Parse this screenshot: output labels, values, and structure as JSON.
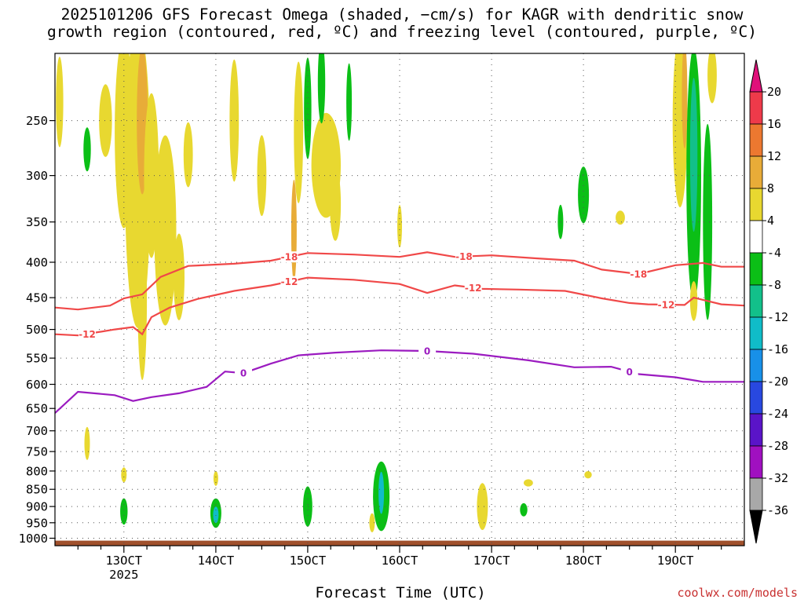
{
  "title_line1": "2025101206 GFS Forecast Omega (shaded, −cm/s) for KAGR with dendritic snow",
  "title_line2": "growth region (contoured, red, ºC) and freezing level (contoured, purple, ºC)",
  "credit": "coolwx.com/models",
  "chart_data": {
    "type": "heatmap",
    "title": "2025101206 GFS Forecast Omega (shaded, −cm/s) for KAGR with dendritic snow growth region (contoured, red, ºC) and freezing level (contoured, purple, ºC)",
    "xlabel": "Forecast Time (UTC)",
    "ylabel": "",
    "x_ticks": [
      {
        "label": "13OCT",
        "day": 13,
        "sublabel": "2025"
      },
      {
        "label": "14OCT",
        "day": 14
      },
      {
        "label": "15OCT",
        "day": 15
      },
      {
        "label": "16OCT",
        "day": 16
      },
      {
        "label": "17OCT",
        "day": 17
      },
      {
        "label": "18OCT",
        "day": 18
      },
      {
        "label": "19OCT",
        "day": 19
      }
    ],
    "xlim_days": [
      12.25,
      19.75
    ],
    "y_ticks": [
      250,
      300,
      350,
      400,
      450,
      500,
      550,
      600,
      650,
      700,
      750,
      800,
      850,
      900,
      950,
      1000
    ],
    "ylim_hpa": [
      1025,
      200
    ],
    "y_scale": "log",
    "grid": true,
    "colorbar": {
      "labels": [
        "20",
        "16",
        "12",
        "8",
        "4",
        "-4",
        "-8",
        "-12",
        "-16",
        "-20",
        "-24",
        "-28",
        "-32",
        "-36"
      ],
      "colors": [
        "#ee3a4a",
        "#ec7830",
        "#e8ac38",
        "#e8d830",
        "#ffffff",
        "#0bbf16",
        "#12c08a",
        "#10bcc8",
        "#1890e8",
        "#2848e0",
        "#5a14c8",
        "#a010c0",
        "#a8a8a8"
      ],
      "top_arrow_color": "#e0107a",
      "bottom_arrow_color": "#000000"
    },
    "contours": [
      {
        "name": "-18",
        "color": "#f04848",
        "labels_at_days": [
          14.8,
          16.7,
          18.6
        ],
        "points": [
          [
            12.25,
            465
          ],
          [
            12.5,
            468
          ],
          [
            12.85,
            462
          ],
          [
            13.0,
            451
          ],
          [
            13.2,
            445
          ],
          [
            13.4,
            420
          ],
          [
            13.7,
            405
          ],
          [
            14.2,
            402
          ],
          [
            14.6,
            398
          ],
          [
            15.0,
            388
          ],
          [
            15.5,
            390
          ],
          [
            16.0,
            393
          ],
          [
            16.3,
            387
          ],
          [
            16.6,
            393
          ],
          [
            17.0,
            391
          ],
          [
            17.5,
            395
          ],
          [
            17.9,
            398
          ],
          [
            18.2,
            410
          ],
          [
            18.6,
            416
          ],
          [
            19.0,
            404
          ],
          [
            19.3,
            401
          ],
          [
            19.5,
            406
          ],
          [
            19.75,
            406
          ]
        ]
      },
      {
        "name": "-12",
        "color": "#f04848",
        "labels_at_days": [
          12.6,
          14.8,
          16.8,
          18.9
        ],
        "points": [
          [
            12.25,
            508
          ],
          [
            12.5,
            510
          ],
          [
            12.9,
            500
          ],
          [
            13.1,
            496
          ],
          [
            13.2,
            508
          ],
          [
            13.3,
            480
          ],
          [
            13.5,
            465
          ],
          [
            13.8,
            452
          ],
          [
            14.2,
            440
          ],
          [
            14.6,
            432
          ],
          [
            15.0,
            421
          ],
          [
            15.5,
            424
          ],
          [
            16.0,
            430
          ],
          [
            16.3,
            443
          ],
          [
            16.6,
            432
          ],
          [
            16.9,
            437
          ],
          [
            17.3,
            438
          ],
          [
            17.8,
            440
          ],
          [
            18.2,
            451
          ],
          [
            18.5,
            458
          ],
          [
            18.7,
            460
          ],
          [
            19.1,
            461
          ],
          [
            19.2,
            450
          ],
          [
            19.5,
            460
          ],
          [
            19.75,
            462
          ]
        ]
      },
      {
        "name": "0",
        "color": "#9b1bc0",
        "labels_at_days": [
          14.3,
          16.3,
          18.5
        ],
        "points": [
          [
            12.25,
            660
          ],
          [
            12.5,
            615
          ],
          [
            12.9,
            622
          ],
          [
            13.1,
            634
          ],
          [
            13.3,
            626
          ],
          [
            13.6,
            618
          ],
          [
            13.9,
            605
          ],
          [
            14.1,
            575
          ],
          [
            14.3,
            578
          ],
          [
            14.6,
            560
          ],
          [
            14.9,
            545
          ],
          [
            15.3,
            540
          ],
          [
            15.8,
            536
          ],
          [
            16.3,
            537
          ],
          [
            16.8,
            542
          ],
          [
            17.4,
            554
          ],
          [
            17.9,
            567
          ],
          [
            18.3,
            566
          ],
          [
            18.6,
            580
          ],
          [
            19.0,
            586
          ],
          [
            19.3,
            595
          ],
          [
            19.75,
            595
          ]
        ]
      }
    ]
  }
}
